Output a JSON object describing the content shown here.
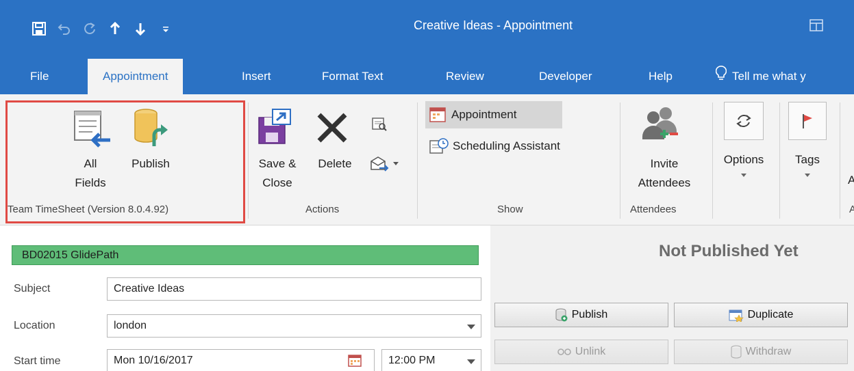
{
  "window": {
    "title": "Creative Ideas  -  Appointment"
  },
  "tabs": [
    {
      "label": "File"
    },
    {
      "label": "Appointment"
    },
    {
      "label": "Insert"
    },
    {
      "label": "Format Text"
    },
    {
      "label": "Review"
    },
    {
      "label": "Developer"
    },
    {
      "label": "Help"
    },
    {
      "label": "Tell me what y"
    }
  ],
  "ribbon": {
    "team_group": {
      "label": "Team TimeSheet (Version 8.0.4.92)",
      "all_fields_line1": "All",
      "all_fields_line2": "Fields",
      "publish": "Publish"
    },
    "actions_group": {
      "label": "Actions",
      "save_close_line1": "Save &",
      "save_close_line2": "Close",
      "delete": "Delete"
    },
    "show_group": {
      "label": "Show",
      "appointment": "Appointment",
      "scheduling_assistant": "Scheduling Assistant"
    },
    "attendees_group": {
      "label": "Attendees",
      "invite_line1": "Invite",
      "invite_line2": "Attendees"
    },
    "options": "Options",
    "tags": "Tags",
    "cut_letter": "A",
    "cut_group_letter": "A"
  },
  "form": {
    "category": "BD02015 GlidePath",
    "subject_label": "Subject",
    "subject_value": "Creative Ideas",
    "location_label": "Location",
    "location_value": "london",
    "start_label": "Start time",
    "start_date": "Mon 10/16/2017",
    "start_time": "12:00 PM"
  },
  "panel": {
    "status": "Not Published Yet",
    "publish": "Publish",
    "duplicate": "Duplicate",
    "unlink": "Unlink",
    "withdraw": "Withdraw"
  },
  "colors": {
    "accent": "#2b72c4",
    "category": "#5fbd78",
    "highlight": "#e04a44"
  }
}
